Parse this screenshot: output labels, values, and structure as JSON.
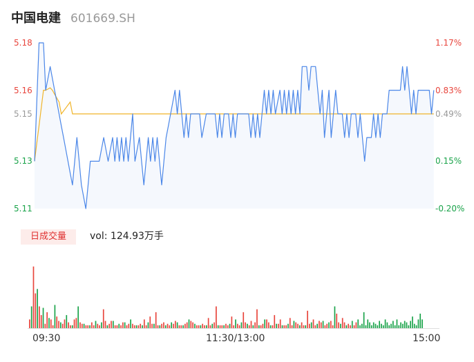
{
  "header": {
    "name": "中国电建",
    "code": "601669.SH"
  },
  "colors": {
    "up": "#e8453c",
    "down": "#1aa34a",
    "flat": "#999999",
    "price_line": "#4a86e8",
    "avg_line": "#f0b429"
  },
  "chart_data": [
    {
      "type": "line",
      "title": "",
      "x_ticks": [
        "09:30",
        "11:30/13:00",
        "15:00"
      ],
      "ylim": [
        5.11,
        5.18
      ],
      "left_ticks": [
        {
          "label": "5.18",
          "value": 5.18,
          "tone": "up"
        },
        {
          "label": "5.16",
          "value": 5.16,
          "tone": "up"
        },
        {
          "label": "5.15",
          "value": 5.15,
          "tone": "flat"
        },
        {
          "label": "5.13",
          "value": 5.13,
          "tone": "down"
        },
        {
          "label": "5.11",
          "value": 5.11,
          "tone": "down"
        }
      ],
      "right_ticks": [
        {
          "label": "1.17%",
          "value": 5.18,
          "tone": "up"
        },
        {
          "label": "0.83%",
          "value": 5.16,
          "tone": "up"
        },
        {
          "label": "0.49%",
          "value": 5.15,
          "tone": "flat"
        },
        {
          "label": "0.15%",
          "value": 5.13,
          "tone": "down"
        },
        {
          "label": "-0.20%",
          "value": 5.11,
          "tone": "down"
        }
      ],
      "series": [
        {
          "role": "price",
          "points": [
            [
              0,
              5.13
            ],
            [
              2,
              5.18
            ],
            [
              4,
              5.18
            ],
            [
              5,
              5.16
            ],
            [
              7,
              5.17
            ],
            [
              9,
              5.16
            ],
            [
              11,
              5.15
            ],
            [
              13,
              5.14
            ],
            [
              15,
              5.13
            ],
            [
              17,
              5.12
            ],
            [
              19,
              5.14
            ],
            [
              21,
              5.12
            ],
            [
              23,
              5.11
            ],
            [
              25,
              5.13
            ],
            [
              29,
              5.13
            ],
            [
              31,
              5.14
            ],
            [
              33,
              5.13
            ],
            [
              35,
              5.14
            ],
            [
              36,
              5.13
            ],
            [
              37,
              5.14
            ],
            [
              38,
              5.13
            ],
            [
              39,
              5.14
            ],
            [
              40,
              5.13
            ],
            [
              41,
              5.14
            ],
            [
              42,
              5.13
            ],
            [
              44,
              5.15
            ],
            [
              45,
              5.13
            ],
            [
              47,
              5.14
            ],
            [
              49,
              5.12
            ],
            [
              51,
              5.14
            ],
            [
              52,
              5.13
            ],
            [
              53,
              5.14
            ],
            [
              54,
              5.13
            ],
            [
              55,
              5.14
            ],
            [
              57,
              5.12
            ],
            [
              59,
              5.14
            ],
            [
              61,
              5.15
            ],
            [
              63,
              5.16
            ],
            [
              64,
              5.15
            ],
            [
              65,
              5.16
            ],
            [
              66,
              5.15
            ],
            [
              67,
              5.14
            ],
            [
              68,
              5.15
            ],
            [
              69,
              5.14
            ],
            [
              70,
              5.15
            ],
            [
              74,
              5.15
            ],
            [
              75,
              5.14
            ],
            [
              77,
              5.15
            ],
            [
              81,
              5.15
            ],
            [
              82,
              5.14
            ],
            [
              83,
              5.15
            ],
            [
              84,
              5.14
            ],
            [
              85,
              5.15
            ],
            [
              87,
              5.15
            ],
            [
              88,
              5.14
            ],
            [
              89,
              5.15
            ],
            [
              90,
              5.14
            ],
            [
              91,
              5.15
            ],
            [
              96,
              5.15
            ],
            [
              97,
              5.14
            ],
            [
              98,
              5.15
            ],
            [
              99,
              5.14
            ],
            [
              100,
              5.15
            ],
            [
              101,
              5.14
            ],
            [
              102,
              5.15
            ],
            [
              103,
              5.16
            ],
            [
              104,
              5.15
            ],
            [
              105,
              5.16
            ],
            [
              106,
              5.15
            ],
            [
              107,
              5.16
            ],
            [
              108,
              5.15
            ],
            [
              110,
              5.16
            ],
            [
              111,
              5.15
            ],
            [
              112,
              5.16
            ],
            [
              113,
              5.15
            ],
            [
              114,
              5.16
            ],
            [
              115,
              5.15
            ],
            [
              116,
              5.16
            ],
            [
              117,
              5.15
            ],
            [
              118,
              5.16
            ],
            [
              119,
              5.15
            ],
            [
              120,
              5.17
            ],
            [
              122,
              5.17
            ],
            [
              123,
              5.16
            ],
            [
              124,
              5.17
            ],
            [
              126,
              5.17
            ],
            [
              127,
              5.16
            ],
            [
              128,
              5.15
            ],
            [
              129,
              5.16
            ],
            [
              130,
              5.14
            ],
            [
              131,
              5.15
            ],
            [
              132,
              5.16
            ],
            [
              133,
              5.14
            ],
            [
              134,
              5.15
            ],
            [
              135,
              5.16
            ],
            [
              136,
              5.15
            ],
            [
              138,
              5.15
            ],
            [
              139,
              5.14
            ],
            [
              140,
              5.15
            ],
            [
              141,
              5.14
            ],
            [
              142,
              5.15
            ],
            [
              144,
              5.15
            ],
            [
              145,
              5.14
            ],
            [
              146,
              5.15
            ],
            [
              148,
              5.13
            ],
            [
              149,
              5.14
            ],
            [
              151,
              5.14
            ],
            [
              152,
              5.15
            ],
            [
              153,
              5.14
            ],
            [
              154,
              5.15
            ],
            [
              155,
              5.14
            ],
            [
              156,
              5.15
            ],
            [
              158,
              5.15
            ],
            [
              159,
              5.16
            ],
            [
              164,
              5.16
            ],
            [
              165,
              5.17
            ],
            [
              166,
              5.16
            ],
            [
              167,
              5.17
            ],
            [
              168,
              5.16
            ],
            [
              169,
              5.15
            ],
            [
              170,
              5.16
            ],
            [
              171,
              5.15
            ],
            [
              172,
              5.16
            ],
            [
              177,
              5.16
            ],
            [
              178,
              5.15
            ],
            [
              179,
              5.16
            ]
          ]
        },
        {
          "role": "average",
          "points": [
            [
              0,
              5.13
            ],
            [
              4,
              5.16
            ],
            [
              5,
              5.16
            ],
            [
              7,
              5.161
            ],
            [
              8,
              5.16
            ],
            [
              11,
              5.155
            ],
            [
              12,
              5.15
            ],
            [
              16,
              5.155
            ],
            [
              17,
              5.15
            ],
            [
              179,
              5.15
            ]
          ]
        }
      ]
    },
    {
      "type": "bar",
      "title": "日成交量",
      "label": "vol: 124.93万手",
      "ymax": 100,
      "up": [
        12,
        85,
        48,
        30,
        18,
        6,
        22,
        12,
        4,
        16,
        10,
        6,
        12,
        8,
        4,
        12,
        14,
        8,
        6,
        4,
        4,
        8,
        4,
        6,
        4,
        26,
        10,
        6,
        10,
        4,
        4,
        4,
        8,
        4,
        6,
        6,
        4,
        4,
        6,
        12,
        4,
        16,
        6,
        22,
        4,
        6,
        8,
        6,
        4,
        6,
        10,
        4,
        4,
        6,
        8,
        10,
        8,
        4,
        4,
        6,
        4,
        14,
        4,
        8,
        30,
        4,
        4,
        6,
        4,
        16,
        4,
        6,
        4,
        22,
        8,
        4,
        10,
        8,
        26,
        4,
        6,
        12,
        8,
        4,
        18,
        6,
        12,
        4,
        4,
        14,
        4,
        8,
        6,
        8,
        4,
        24,
        6,
        12,
        4,
        10,
        8,
        4,
        6,
        10,
        4,
        20,
        8,
        14,
        8,
        6,
        4,
        4,
        8
      ],
      "down": [
        30,
        54,
        28,
        14,
        32,
        8,
        18,
        4,
        30,
        6,
        4,
        10,
        8,
        4,
        10,
        6,
        8,
        12,
        4,
        4,
        8,
        6,
        4,
        4,
        8,
        8,
        4,
        12,
        6,
        4,
        4,
        6,
        4,
        4,
        6,
        12,
        8,
        6,
        4,
        4,
        12,
        4,
        6,
        4,
        6,
        10,
        4,
        4,
        8,
        6,
        10,
        8,
        30,
        6,
        4,
        10,
        12,
        4,
        6,
        22,
        4,
        12,
        8,
        4,
        8,
        6,
        4,
        10,
        6,
        4,
        12,
        8,
        4,
        6,
        10,
        4,
        12,
        4,
        8,
        6,
        10,
        8,
        4,
        10,
        16,
        6,
        4,
        12,
        20,
        12
      ]
    }
  ]
}
